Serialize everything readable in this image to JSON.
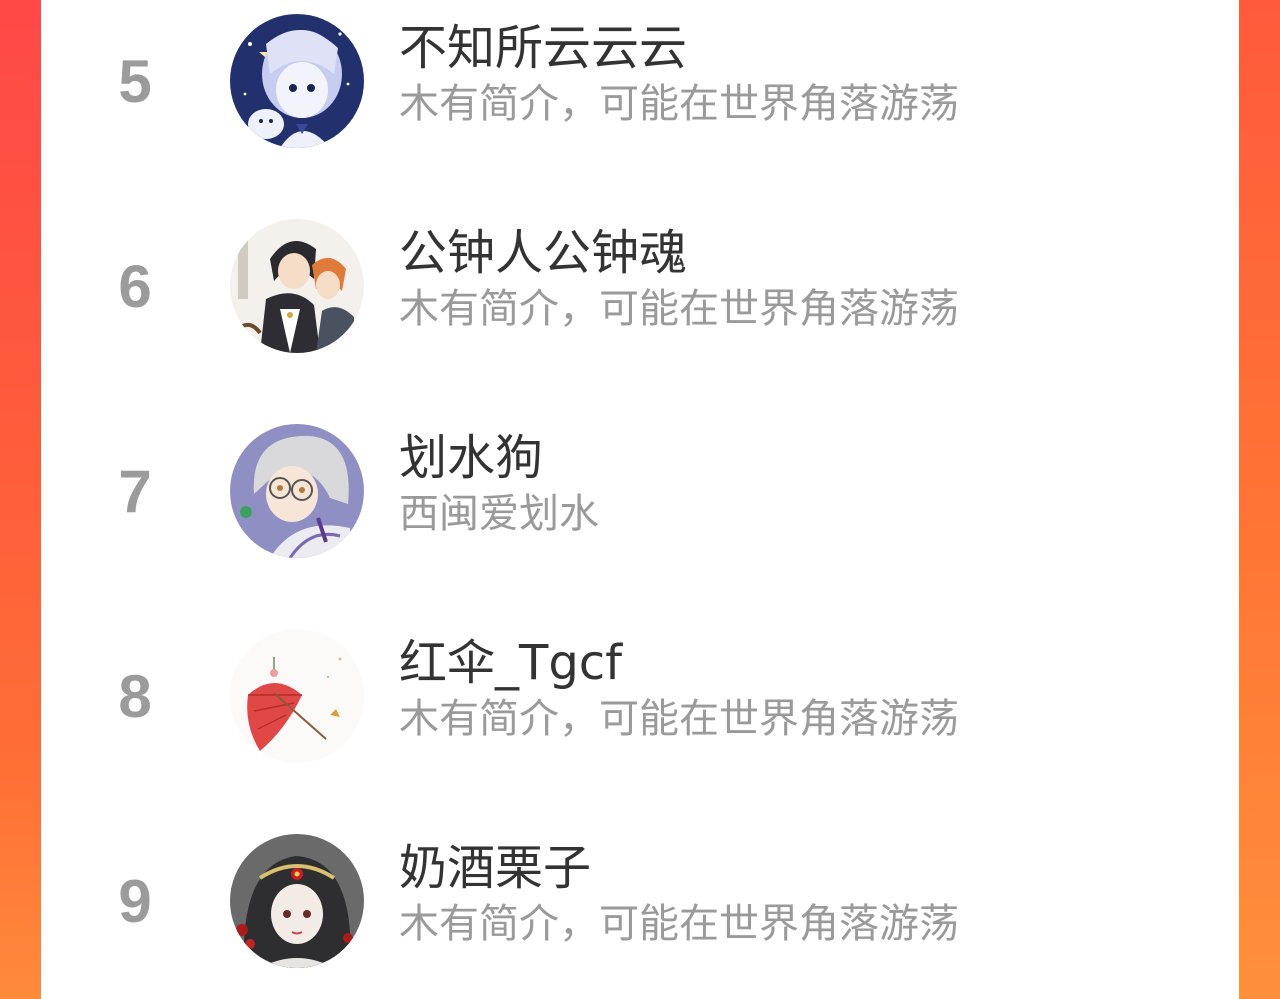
{
  "ranking_list": {
    "items": [
      {
        "rank": "5",
        "name": "不知所云云云",
        "bio": "木有简介，可能在世界角落游荡",
        "avatar_icon": "anime-girl-avatar-icon"
      },
      {
        "rank": "6",
        "name": "公钟人公钟魂",
        "bio": "木有简介，可能在世界角落游荡",
        "avatar_icon": "anime-couple-avatar-icon"
      },
      {
        "rank": "7",
        "name": "划水狗",
        "bio": "西闽爱划水",
        "avatar_icon": "anime-boy-glasses-avatar-icon"
      },
      {
        "rank": "8",
        "name": "红伞_Tgcf",
        "bio": "木有简介，可能在世界角落游荡",
        "avatar_icon": "red-umbrella-avatar-icon"
      },
      {
        "rank": "9",
        "name": "奶酒栗子",
        "bio": "木有简介，可能在世界角落游荡",
        "avatar_icon": "anime-girl-headdress-avatar-icon"
      }
    ]
  },
  "colors": {
    "background_gradient_top": "#ff4848",
    "background_gradient_bottom": "#ff8a3a",
    "panel": "#ffffff",
    "rank_text": "#9b9b9b",
    "name_text": "#333333",
    "bio_text": "#9a9a9a"
  }
}
